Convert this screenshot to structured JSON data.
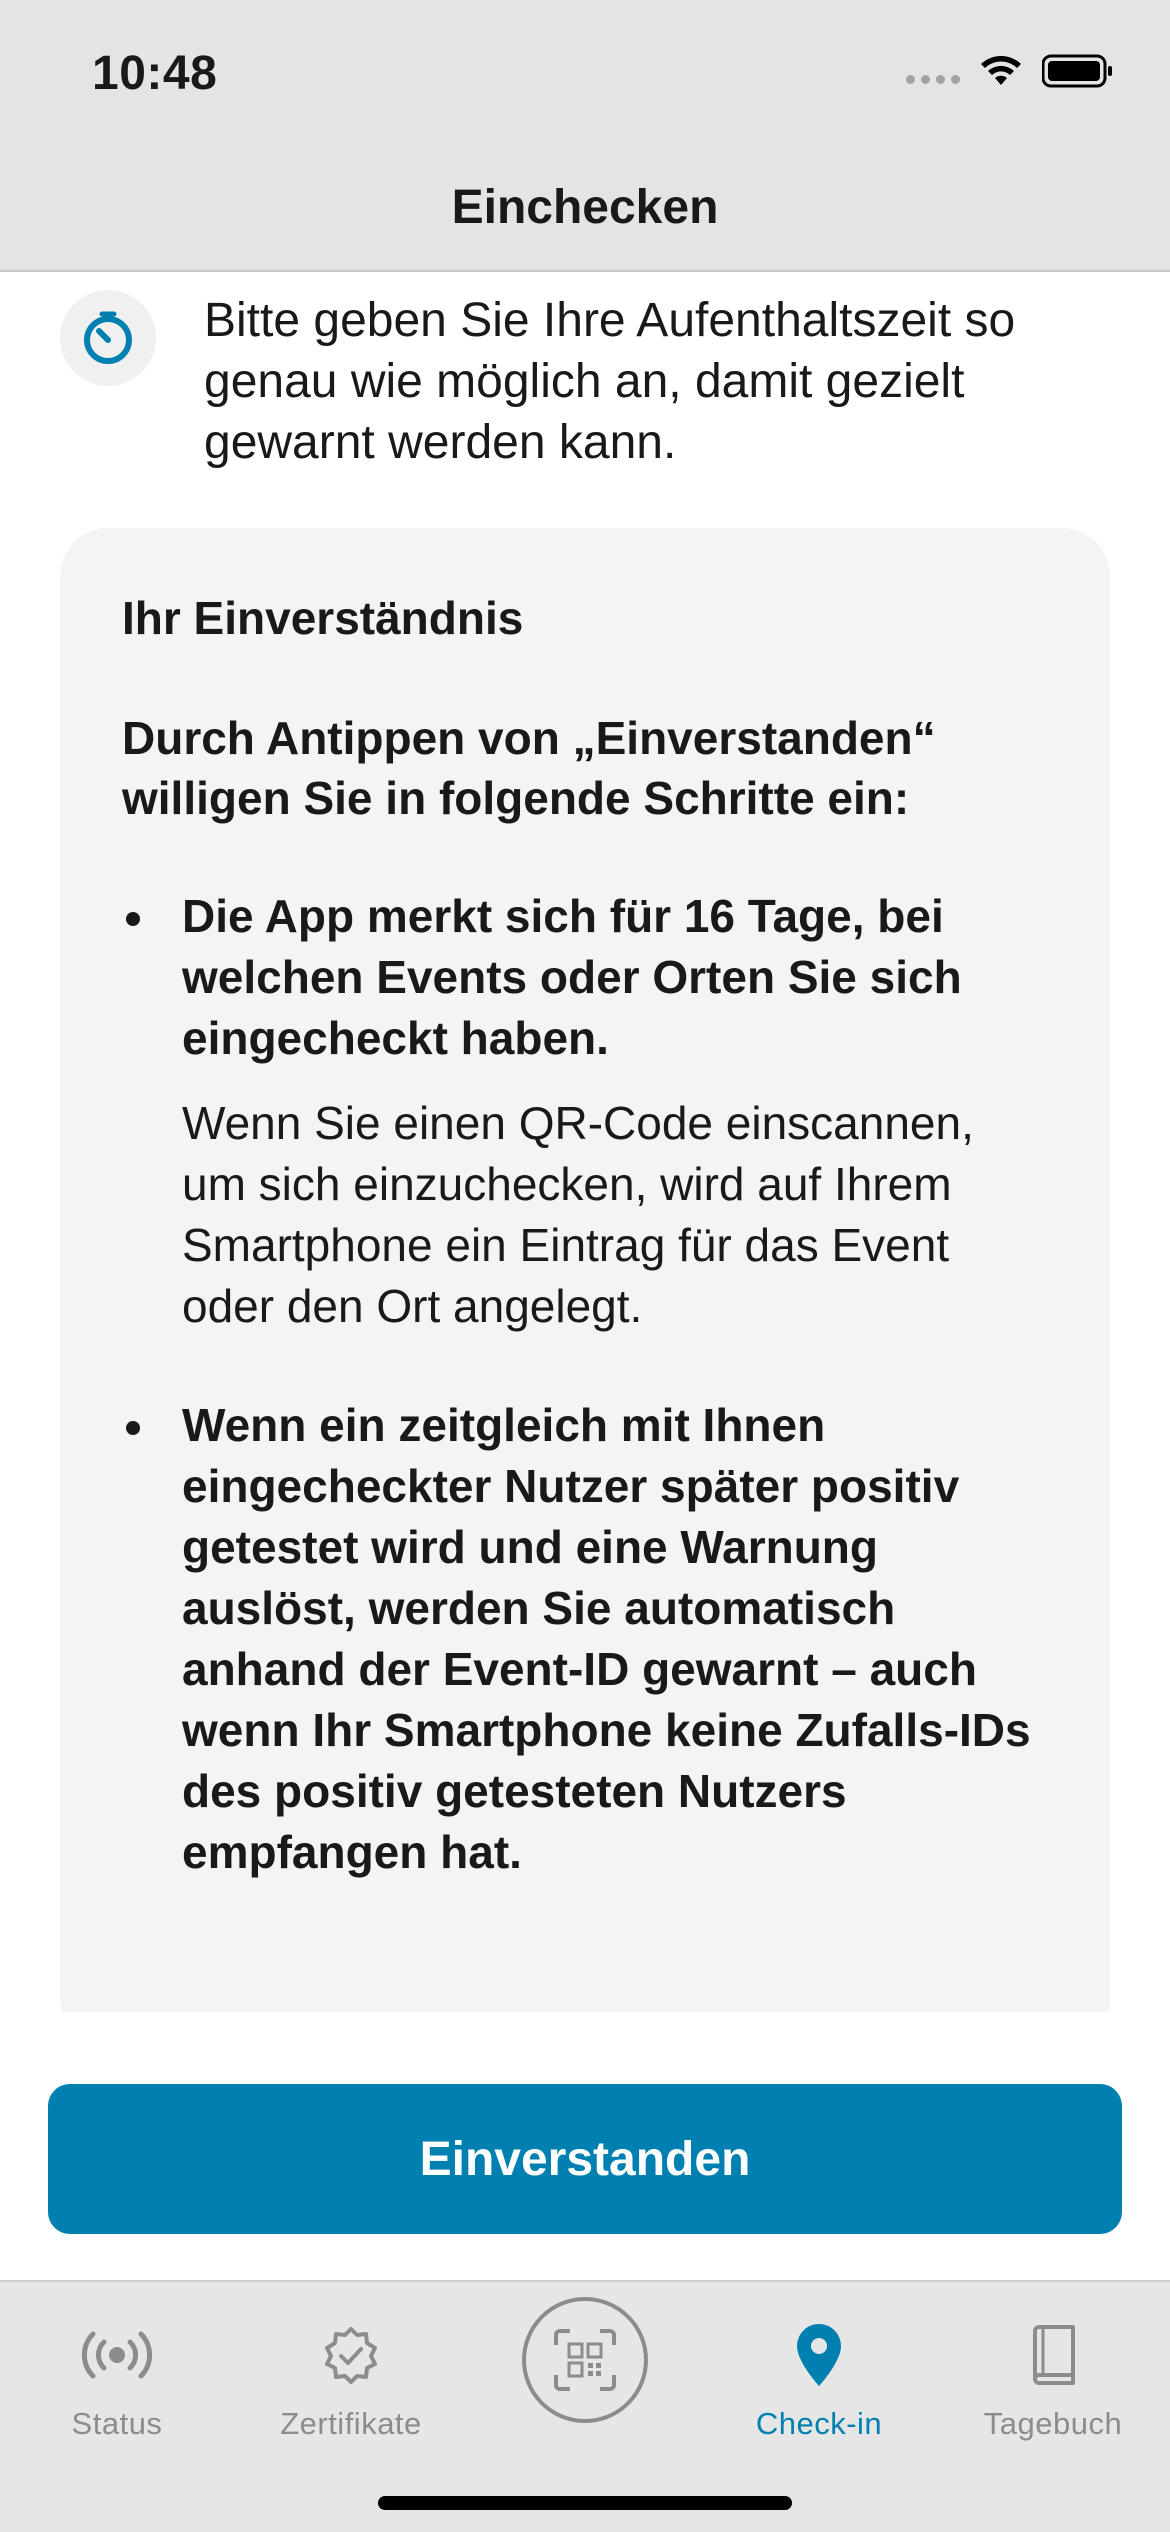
{
  "status_bar": {
    "time": "10:48"
  },
  "nav": {
    "title": "Einchecken"
  },
  "info": {
    "text": "Bitte geben Sie Ihre Aufenthaltszeit so genau wie möglich an, damit gezielt gewarnt werden kann.",
    "icon": "timer-icon"
  },
  "consent": {
    "title": "Ihr Einverständnis",
    "lead": "Durch Antippen von „Einverstanden“ willigen Sie in folgende Schritte ein:",
    "bullets": [
      {
        "bold": "Die App merkt sich für 16 Tage, bei welchen Events oder Orten Sie sich eingecheckt haben.",
        "body": "Wenn Sie einen QR-Code einscannen, um sich einzuchecken, wird auf Ihrem Smartphone ein Eintrag für das Event oder den Ort angelegt."
      },
      {
        "bold": "Wenn ein zeitgleich mit Ihnen eingecheckter Nutzer später positiv getestet wird und eine Warnung auslöst, werden Sie automatisch anhand der Event-ID gewarnt – auch wenn Ihr Smartphone keine Zufalls-IDs des positiv getesteten Nutzers empfangen hat."
      }
    ]
  },
  "button": {
    "label": "Einverstanden"
  },
  "tabbar": {
    "items": [
      {
        "label": "Status",
        "icon": "broadcast-icon",
        "active": false
      },
      {
        "label": "Zertifikate",
        "icon": "certificate-badge-icon",
        "active": false
      },
      {
        "label": "",
        "icon": "qr-scan-icon",
        "active": false
      },
      {
        "label": "Check-in",
        "icon": "location-pin-icon",
        "active": true
      },
      {
        "label": "Tagebuch",
        "icon": "book-icon",
        "active": false
      }
    ]
  },
  "colors": {
    "accent": "#0080b0",
    "inactive": "#8c8c8c",
    "card": "#f4f4f4"
  }
}
